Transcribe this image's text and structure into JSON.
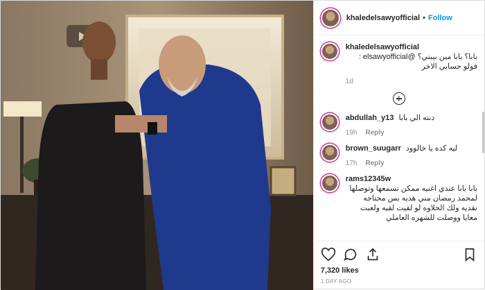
{
  "header": {
    "username": "khaledelsawyofficial",
    "separator": "•",
    "follow_label": "Follow"
  },
  "caption": {
    "username": "khaledelsawyofficial",
    "text": "بابا؟ بابا مين بيبني؟ @elsawyofficial : فولو حسابي الاخر",
    "age": "1d"
  },
  "comments": [
    {
      "username": "abdullah_y13",
      "text": "دنته الي بابا",
      "age": "19h",
      "reply_label": "Reply"
    },
    {
      "username": "brown_suugarr",
      "text": "ليه كده يا خالوود",
      "age": "17h",
      "reply_label": "Reply"
    },
    {
      "username": "rams12345w",
      "text": "بابا بابا عندي اغنيه ممكن تسمعها وتوصلها لمحمد رمضان مني هديه بس محتاجه نقديه ولك الحلاوه لو لقيت لقيه ولعبت معايا ووصلت للشهره العاملي"
    }
  ],
  "actions": {
    "icons": [
      "heart-icon",
      "comment-icon",
      "share-icon",
      "bookmark-icon"
    ]
  },
  "likes": "7,320 likes",
  "timestamp": "1 DAY AGO"
}
